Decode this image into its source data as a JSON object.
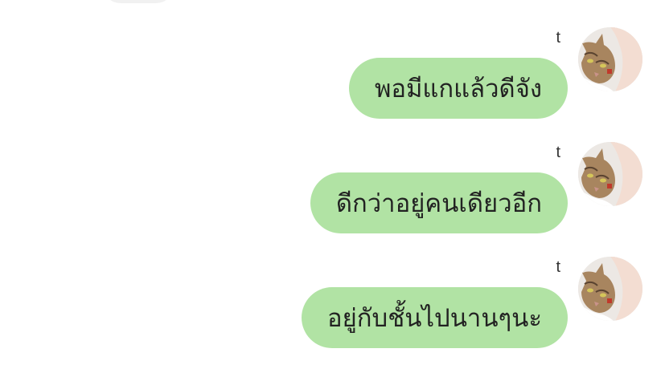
{
  "messages": [
    {
      "sender": "t",
      "text": "พอมีแกแล้วดีจัง",
      "avatar_icon": "cat-kiss-avatar-icon"
    },
    {
      "sender": "t",
      "text": "ดีกว่าอยู่คนเดียวอีก",
      "avatar_icon": "cat-kiss-avatar-icon"
    },
    {
      "sender": "t",
      "text": "อยู่กับชั้นไปนานๆนะ",
      "avatar_icon": "cat-kiss-avatar-icon"
    }
  ],
  "colors": {
    "bubble": "#b1e3a4",
    "text": "#222222",
    "background": "#ffffff"
  }
}
